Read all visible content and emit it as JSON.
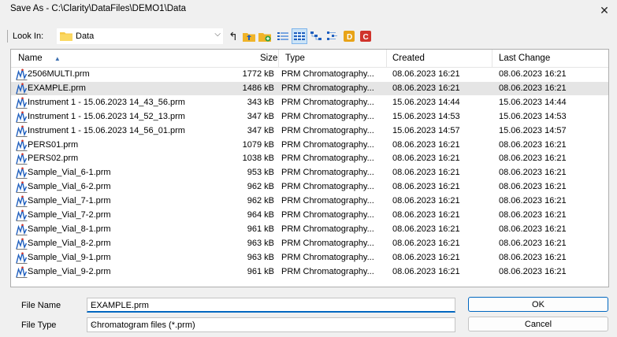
{
  "window": {
    "title": "Save As - C:\\Clarity\\DataFiles\\DEMO1\\Data",
    "close_glyph": "✕"
  },
  "toolbar": {
    "look_in_label": "Look In:",
    "current_folder": "Data",
    "dropdown_glyph": "⌵",
    "back_glyph": "↰",
    "icons": [
      "back-icon",
      "up-folder-icon",
      "new-folder-icon",
      "list-view-icon",
      "details-view-icon",
      "tree-view-icon",
      "thumbnails-view-icon",
      "database-d-icon",
      "database-c-icon"
    ]
  },
  "columns": {
    "name": "Name",
    "sort_glyph": "▲",
    "size": "Size",
    "type": "Type",
    "created": "Created",
    "last_change": "Last Change"
  },
  "files": [
    {
      "name": "2506MULTI.prm",
      "size": "1772 kB",
      "type": "PRM Chromatography...",
      "created": "08.06.2023 16:21",
      "last": "08.06.2023 16:21"
    },
    {
      "name": "EXAMPLE.prm",
      "size": "1486 kB",
      "type": "PRM Chromatography...",
      "created": "08.06.2023 16:21",
      "last": "08.06.2023 16:21"
    },
    {
      "name": "Instrument 1 - 15.06.2023 14_43_56.prm",
      "size": "343 kB",
      "type": "PRM Chromatography...",
      "created": "15.06.2023 14:44",
      "last": "15.06.2023 14:44"
    },
    {
      "name": "Instrument 1 - 15.06.2023 14_52_13.prm",
      "size": "347 kB",
      "type": "PRM Chromatography...",
      "created": "15.06.2023 14:53",
      "last": "15.06.2023 14:53"
    },
    {
      "name": "Instrument 1 - 15.06.2023 14_56_01.prm",
      "size": "347 kB",
      "type": "PRM Chromatography...",
      "created": "15.06.2023 14:57",
      "last": "15.06.2023 14:57"
    },
    {
      "name": "PERS01.prm",
      "size": "1079 kB",
      "type": "PRM Chromatography...",
      "created": "08.06.2023 16:21",
      "last": "08.06.2023 16:21"
    },
    {
      "name": "PERS02.prm",
      "size": "1038 kB",
      "type": "PRM Chromatography...",
      "created": "08.06.2023 16:21",
      "last": "08.06.2023 16:21"
    },
    {
      "name": "Sample_Vial_6-1.prm",
      "size": "953 kB",
      "type": "PRM Chromatography...",
      "created": "08.06.2023 16:21",
      "last": "08.06.2023 16:21"
    },
    {
      "name": "Sample_Vial_6-2.prm",
      "size": "962 kB",
      "type": "PRM Chromatography...",
      "created": "08.06.2023 16:21",
      "last": "08.06.2023 16:21"
    },
    {
      "name": "Sample_Vial_7-1.prm",
      "size": "962 kB",
      "type": "PRM Chromatography...",
      "created": "08.06.2023 16:21",
      "last": "08.06.2023 16:21"
    },
    {
      "name": "Sample_Vial_7-2.prm",
      "size": "964 kB",
      "type": "PRM Chromatography...",
      "created": "08.06.2023 16:21",
      "last": "08.06.2023 16:21"
    },
    {
      "name": "Sample_Vial_8-1.prm",
      "size": "961 kB",
      "type": "PRM Chromatography...",
      "created": "08.06.2023 16:21",
      "last": "08.06.2023 16:21"
    },
    {
      "name": "Sample_Vial_8-2.prm",
      "size": "963 kB",
      "type": "PRM Chromatography...",
      "created": "08.06.2023 16:21",
      "last": "08.06.2023 16:21"
    },
    {
      "name": "Sample_Vial_9-1.prm",
      "size": "963 kB",
      "type": "PRM Chromatography...",
      "created": "08.06.2023 16:21",
      "last": "08.06.2023 16:21"
    },
    {
      "name": "Sample_Vial_9-2.prm",
      "size": "961 kB",
      "type": "PRM Chromatography...",
      "created": "08.06.2023 16:21",
      "last": "08.06.2023 16:21"
    }
  ],
  "selected_index": 1,
  "footer": {
    "file_name_label": "File Name",
    "file_name_value": "EXAMPLE.prm",
    "file_type_label": "File Type",
    "file_type_value": "Chromatogram files (*.prm)",
    "dropdown_glyph": "⌵",
    "ok_label": "OK",
    "cancel_label": "Cancel"
  },
  "colors": {
    "accent": "#0067c0",
    "selection": "#e5e5e5",
    "folder": "#f7c948",
    "icon_blue": "#1f5fbf",
    "icon_red": "#d0342c"
  }
}
